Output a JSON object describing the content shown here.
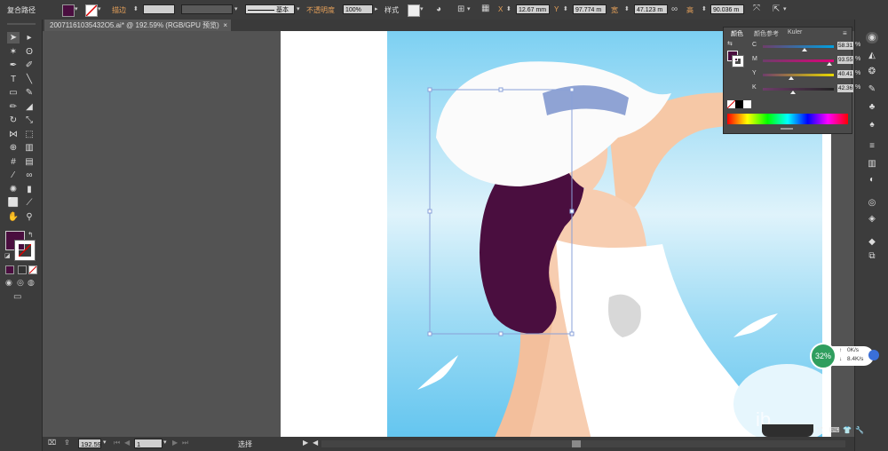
{
  "control_bar": {
    "path_type": "复合路径",
    "stroke_label": "描边",
    "stroke_width": "",
    "stroke_profile": "基本",
    "opacity_label": "不透明度",
    "opacity_value": "100%",
    "style_label": "样式",
    "x_label": "X",
    "x_value": "12.67 mm",
    "y_label": "Y",
    "y_value": "97.774 m",
    "w_label": "宽",
    "w_value": "47.123 m",
    "h_label": "高",
    "h_value": "90.036 m",
    "colors": {
      "fill": "#4a0e3f",
      "stroke": "none",
      "accent_orange": "#e8a25a"
    }
  },
  "document": {
    "tab_label": "20071161035432O5.ai* @ 192.59% (RGB/GPU 预览)",
    "close_icon": "close-icon"
  },
  "tools": [
    "selection-tool",
    "direct-selection-tool",
    "magic-wand-tool",
    "lasso-tool",
    "pen-tool",
    "curvature-tool",
    "type-tool",
    "line-tool",
    "rectangle-tool",
    "paintbrush-tool",
    "pencil-tool",
    "eraser-tool",
    "rotate-tool",
    "scale-tool",
    "width-tool",
    "free-transform-tool",
    "shape-builder-tool",
    "perspective-grid-tool",
    "mesh-tool",
    "gradient-tool",
    "eyedropper-tool",
    "blend-tool",
    "symbol-sprayer-tool",
    "column-graph-tool",
    "artboard-tool",
    "slice-tool",
    "hand-tool",
    "zoom-tool"
  ],
  "color_panel": {
    "tabs": [
      "颜色",
      "颜色参考",
      "Kuler"
    ],
    "fill_color": "#4a0e3f",
    "sliders": [
      {
        "label": "C",
        "value": "58.31",
        "pct": 58.31,
        "color": "#00a0e0"
      },
      {
        "label": "M",
        "value": "93.55",
        "pct": 93.55,
        "color": "#e0007a"
      },
      {
        "label": "Y",
        "value": "40.41",
        "pct": 40.41,
        "color": "#e8d800"
      },
      {
        "label": "K",
        "value": "42.36",
        "pct": 42.36,
        "color": "#222222"
      }
    ],
    "percent": "%"
  },
  "status_bar": {
    "zoom": "192.59",
    "artboard_number": "1",
    "tool_name": "选择"
  },
  "speed_widget": {
    "cpu_percent": "32%",
    "upload": "0K/s",
    "download": "8.4K/s"
  },
  "watermark": "ib"
}
